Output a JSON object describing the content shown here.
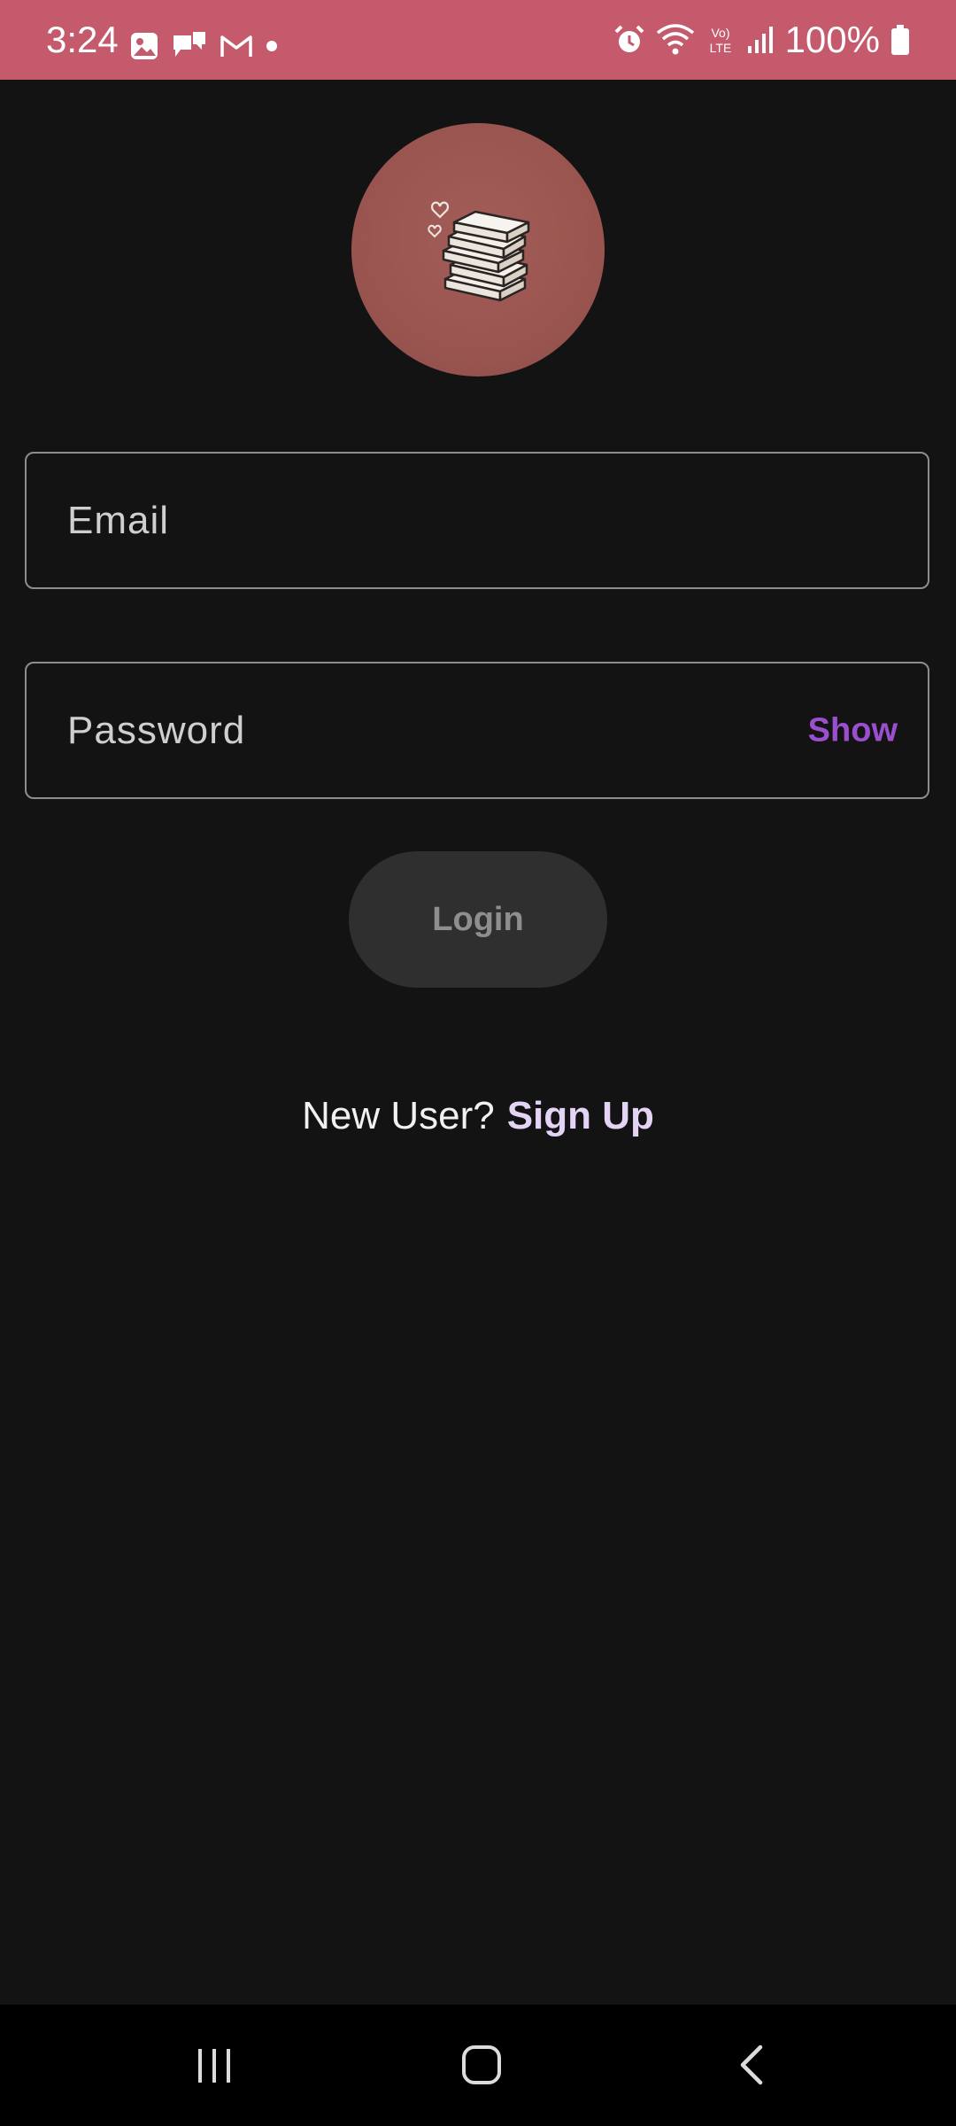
{
  "status_bar": {
    "time": "3:24",
    "battery_percent": "100%",
    "background_color": "#c45a6c",
    "left_icons": [
      "gallery-icon",
      "chat-icon",
      "gmail-icon",
      "dot-icon"
    ],
    "right_icons": [
      "alarm-icon",
      "wifi-icon",
      "volte-icon",
      "signal-icon",
      "battery-icon"
    ]
  },
  "logo": {
    "icon": "books-icon",
    "background_color": "#9d5752"
  },
  "form": {
    "email_placeholder": "Email",
    "password_placeholder": "Password",
    "show_label": "Show",
    "login_label": "Login"
  },
  "signup": {
    "prompt": "New User?",
    "link_label": "Sign Up"
  },
  "nav_bar": {
    "buttons": [
      "recents-icon",
      "home-icon",
      "back-icon"
    ]
  },
  "colors": {
    "background": "#131313",
    "accent_purple": "#9b4fcf",
    "signup_link": "#e3d3f5"
  }
}
